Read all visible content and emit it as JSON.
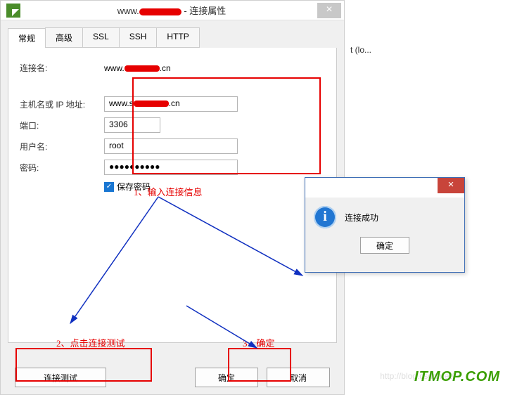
{
  "window": {
    "title_prefix": "www.",
    "title_suffix": " - 连接属性",
    "close": "×"
  },
  "tabs": [
    "常规",
    "高级",
    "SSL",
    "SSH",
    "HTTP"
  ],
  "form": {
    "conn_name_label": "连接名:",
    "conn_name_prefix": "www.",
    "conn_name_suffix": ".cn",
    "host_label": "主机名或 IP 地址:",
    "host_prefix": "www.s",
    "host_suffix": ".cn",
    "port_label": "端口:",
    "port_value": "3306",
    "user_label": "用户名:",
    "user_value": "root",
    "pwd_label": "密码:",
    "pwd_value": "●●●●●●●●●●",
    "save_pwd": "保存密码"
  },
  "annotations": {
    "a1": "1、输入连接信息",
    "a2": "2、点击连接测试",
    "a3": "3、确定"
  },
  "buttons": {
    "test": "连接测试",
    "ok": "确定",
    "cancel": "取消"
  },
  "modal": {
    "msg": "连接成功",
    "ok": "确定",
    "close": "×"
  },
  "side": "t (lo...",
  "watermark": "ITMOP.COM",
  "csdn": "http://blog.csdn.net/"
}
